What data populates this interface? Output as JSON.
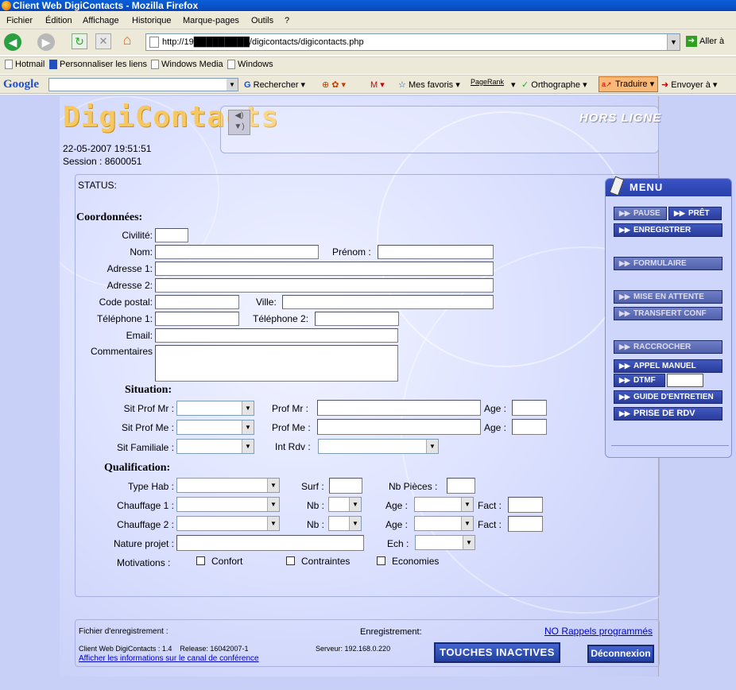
{
  "browser": {
    "title": "Client Web DigiContacts - Mozilla Firefox",
    "menu": [
      "Fichier",
      "Édition",
      "Affichage",
      "Historique",
      "Marque-pages",
      "Outils",
      "?"
    ],
    "url": "http://19█████████/digicontacts/digicontacts.php",
    "go_label": "Aller à",
    "links": [
      "Hotmail",
      "Personnaliser les liens",
      "Windows Media",
      "Windows"
    ],
    "google": {
      "logo": "Google",
      "search_label": "Rechercher",
      "pagerank": "PageRank",
      "mes_favoris": "Mes favoris",
      "orthographe": "Orthographe",
      "traduire": "Traduire",
      "envoyer": "Envoyer à"
    }
  },
  "app": {
    "logo": "DigiContacts",
    "status_mode": "HORS LIGNE",
    "datetime": "22-05-2007 19:51:51",
    "session": "Session : 8600051",
    "status_label": "STATUS:"
  },
  "form": {
    "coordonnees_title": "Coordonnées:",
    "civilite": "Civilité:",
    "nom": "Nom:",
    "prenom": "Prénom :",
    "adresse1": "Adresse 1:",
    "adresse2": "Adresse 2:",
    "code_postal": "Code postal:",
    "ville": "Ville:",
    "telephone1": "Téléphone 1:",
    "telephone2": "Téléphone 2:",
    "email": "Email:",
    "commentaires": "Commentaires",
    "situation_title": "Situation:",
    "sit_prof_mr": "Sit Prof Mr :",
    "prof_mr": "Prof Mr :",
    "age_mr": "Age :",
    "sit_prof_me": "Sit Prof Me :",
    "prof_me": "Prof Me :",
    "age_me": "Age :",
    "sit_familiale": "Sit Familiale :",
    "int_rdv": "Int Rdv :",
    "qualification_title": "Qualification:",
    "type_hab": "Type Hab :",
    "surf": "Surf :",
    "nb_pieces": "Nb Pièces :",
    "chauffage1": "Chauffage 1 :",
    "nb1": "Nb :",
    "age1": "Age :",
    "fact1": "Fact :",
    "chauffage2": "Chauffage 2 :",
    "nb2": "Nb :",
    "age2": "Age :",
    "fact2": "Fact :",
    "nature_projet": "Nature projet :",
    "ech": "Ech :",
    "motivations": "Motivations :",
    "confort": "Confort",
    "contraintes": "Contraintes",
    "economies": "Economies"
  },
  "menu": {
    "title": "MENU",
    "pause": "PAUSE",
    "pret": "PRÊT",
    "enregistrer": "ENREGISTRER",
    "formulaire": "FORMULAIRE",
    "mise_en_attente": "MISE EN ATTENTE",
    "transfert_conf": "TRANSFERT CONF",
    "raccrocher": "RACCROCHER",
    "appel_manuel": "APPEL MANUEL",
    "dtmf": "DTMF",
    "guide_entretien": "GUIDE D'ENTRETIEN",
    "prise_de_rdv": "PRISE DE RDV"
  },
  "footer": {
    "fichier_enregistrement": "Fichier d'enregistrement :",
    "enregistrement": "Enregistrement:",
    "rappels": "NO Rappels programmés",
    "version": "Client Web DigiContacts : 1.4    Release: 16042007-1",
    "serveur": "Serveur: 192.168.0.220",
    "conf_link": "Afficher les informations sur le canal de conférence",
    "touches": "TOUCHES INACTIVES",
    "deconnexion": "Déconnexion"
  }
}
